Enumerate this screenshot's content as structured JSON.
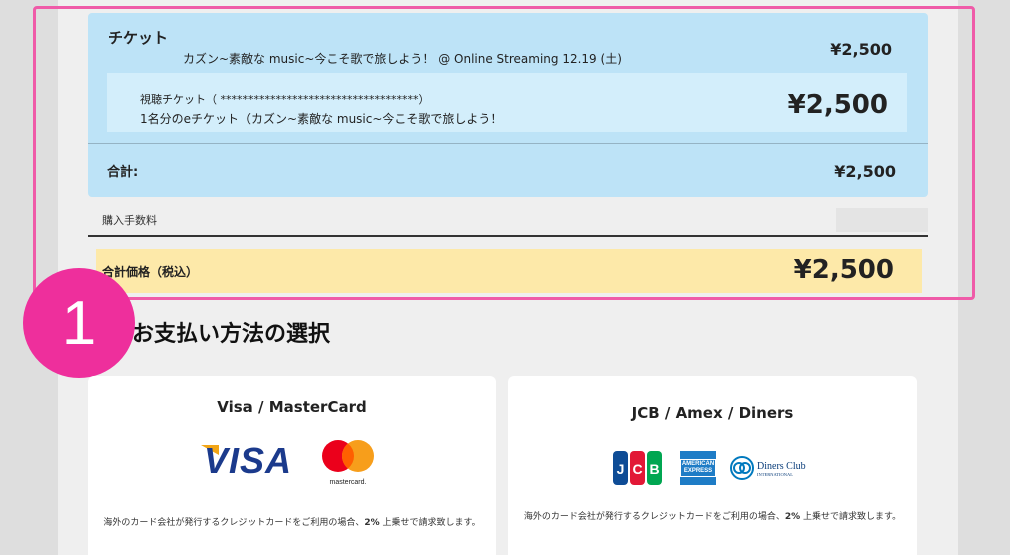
{
  "ticket": {
    "heading": "チケット",
    "event_name": "カズン~素敵な music~今こそ歌で旅しよう！ @ Online Streaming 12.19 (土)",
    "event_price": "¥2,500",
    "item_line1": "視聴チケット（ ************************************）",
    "item_line2": "1名分のeチケット（カズン~素敵な music~今こそ歌で旅しよう！",
    "item_price": "¥2,500",
    "total_label": "合計:",
    "total_price": "¥2,500"
  },
  "fee": {
    "label": "購入手数料"
  },
  "grand_total": {
    "label": "合計価格（税込）",
    "price": "¥2,500"
  },
  "step_badge": "1",
  "payment": {
    "section_title": "お支払い方法の選択",
    "options": [
      {
        "title": "Visa / MasterCard",
        "visa_text": "VISA",
        "mastercard_text": "mastercard.",
        "note_before": "海外のカード会社が発行するクレジットカードをご利用の場合、",
        "note_bold": "2%",
        "note_after": " 上乗せで請求致します。"
      },
      {
        "title": "JCB / Amex / Diners",
        "jcb_text": "JCB",
        "amex_text": "AMERICAN EXPRESS",
        "diners_text": "Diners Club",
        "diners_sub": "INTERNATIONAL",
        "note_before": "海外のカード会社が発行するクレジットカードをご利用の場合、",
        "note_bold": "2%",
        "note_after": " 上乗せで請求致します。"
      }
    ]
  },
  "colors": {
    "ticket_bg": "#bde3f7",
    "highlight": "#ef5ba8",
    "badge": "#ee2f9c",
    "grand_bg": "#fde9a9"
  }
}
